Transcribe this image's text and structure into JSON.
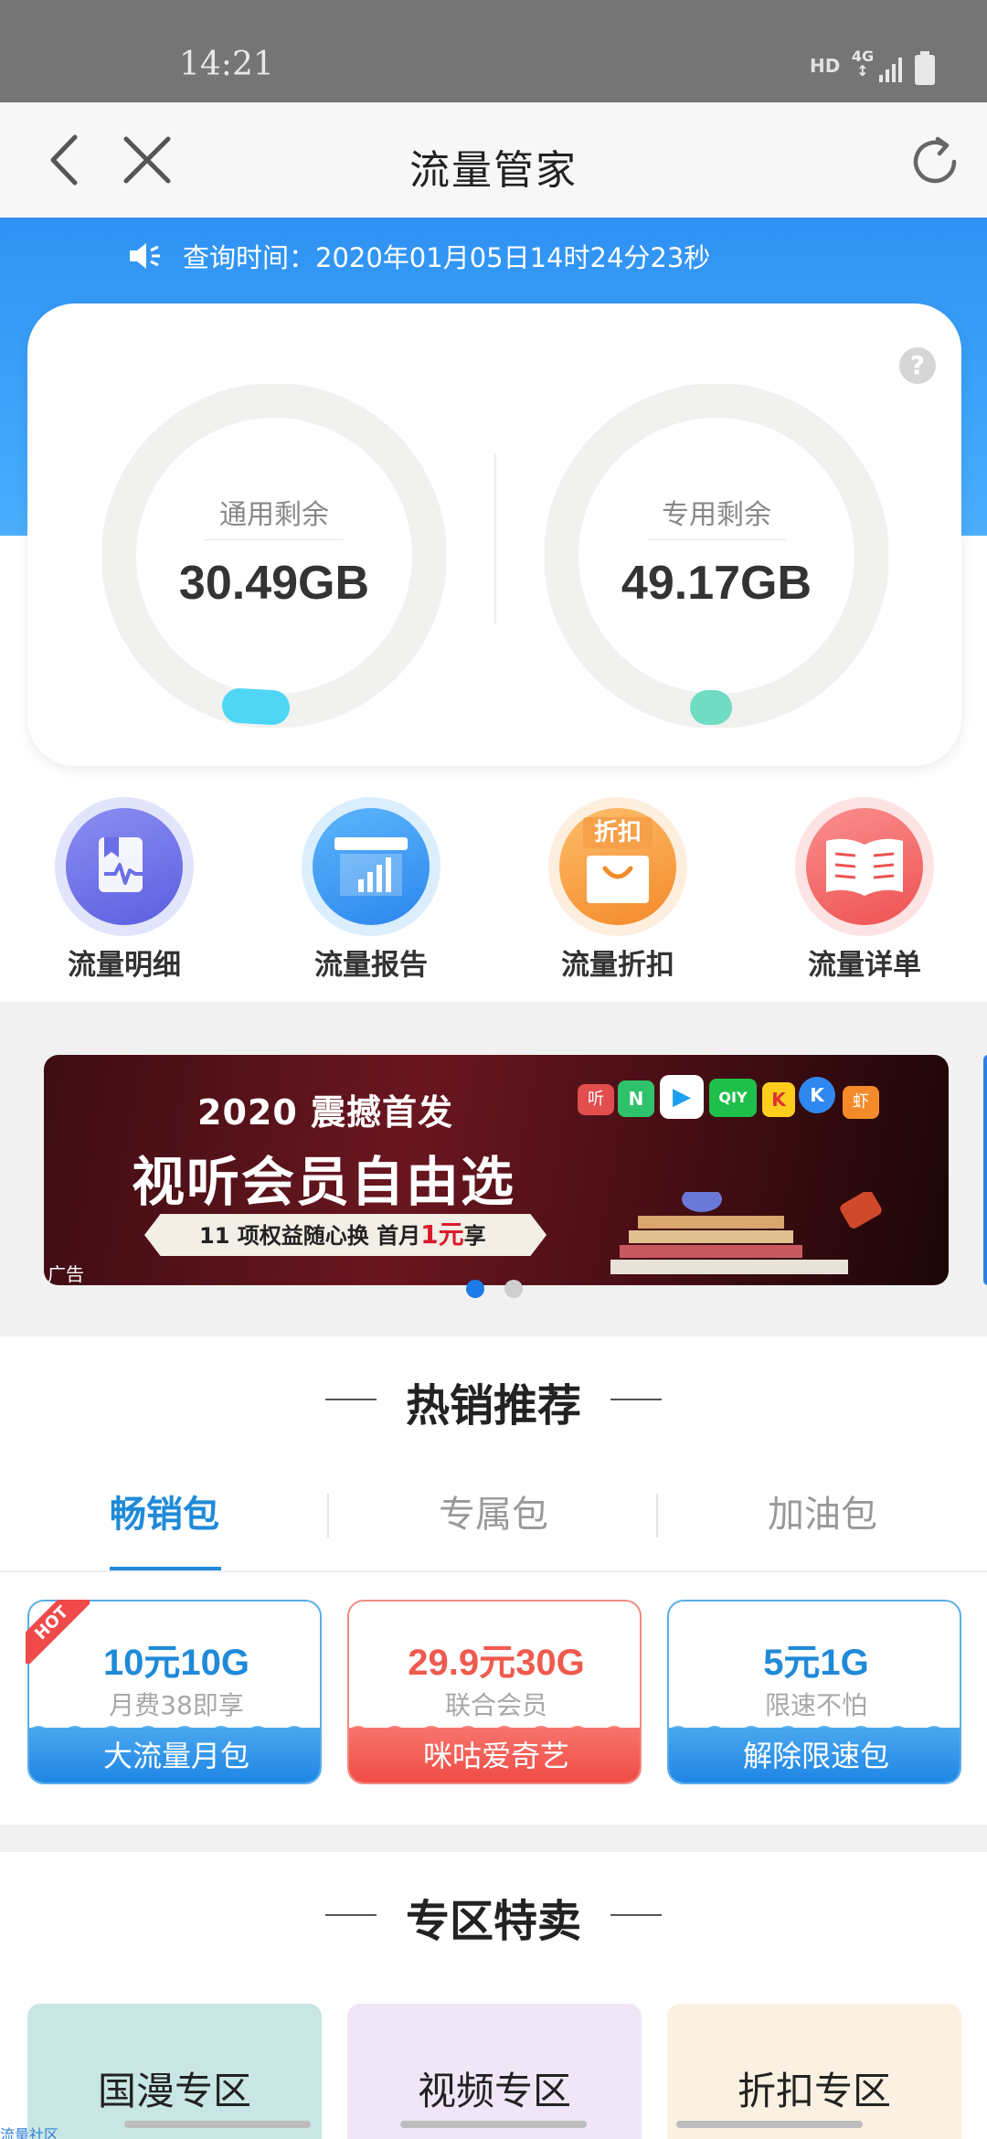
{
  "status_bar": {
    "time": "14:21",
    "hd": "HD",
    "network": "4G"
  },
  "nav": {
    "title": "流量管家"
  },
  "notice": {
    "text": "查询时间：2020年01月05日14时24分23秒"
  },
  "gauges": [
    {
      "label": "通用剩余",
      "value": "30.49GB",
      "color": "#4fd6f5"
    },
    {
      "label": "专用剩余",
      "value": "49.17GB",
      "color": "#6fdcc3"
    }
  ],
  "quick_actions": [
    {
      "label": "流量明细",
      "icon": "detail-chart-icon"
    },
    {
      "label": "流量报告",
      "icon": "report-bars-icon"
    },
    {
      "label": "流量折扣",
      "icon": "discount-bag-icon",
      "badge": "折扣"
    },
    {
      "label": "流量详单",
      "icon": "open-book-icon"
    }
  ],
  "banner": {
    "line1": "2020 震撼首发",
    "line2": "视听会员自由选",
    "line3_a": "11 项权益随心换   首月",
    "line3_price": "1元",
    "line3_b": "享",
    "ad_tag": "广告",
    "app_chips": [
      "听",
      "N",
      "▶",
      "QIY",
      "K",
      "K",
      "虾"
    ]
  },
  "hot_section": {
    "title": "热销推荐",
    "tabs": [
      "畅销包",
      "专属包",
      "加油包"
    ],
    "active_tab": 0,
    "packages": [
      {
        "main": "10元10G",
        "sub": "月费38即享",
        "foot": "大流量月包",
        "color": "#1f8ad8",
        "hot": "HOT"
      },
      {
        "main": "29.9元30G",
        "sub": "联合会员",
        "foot": "咪咕爱奇艺",
        "color": "#ef5a4f"
      },
      {
        "main": "5元1G",
        "sub": "限速不怕",
        "foot": "解除限速包",
        "color": "#1f8ad8"
      }
    ]
  },
  "zone_section": {
    "title": "专区特卖",
    "zones": [
      {
        "label": "国漫专区",
        "bg": "#c8e6e4"
      },
      {
        "label": "视频专区",
        "bg": "#f0e6f8"
      },
      {
        "label": "折扣专区",
        "bg": "#fbf1e2"
      }
    ]
  },
  "bottom": {
    "flow_link": "流量社区"
  }
}
